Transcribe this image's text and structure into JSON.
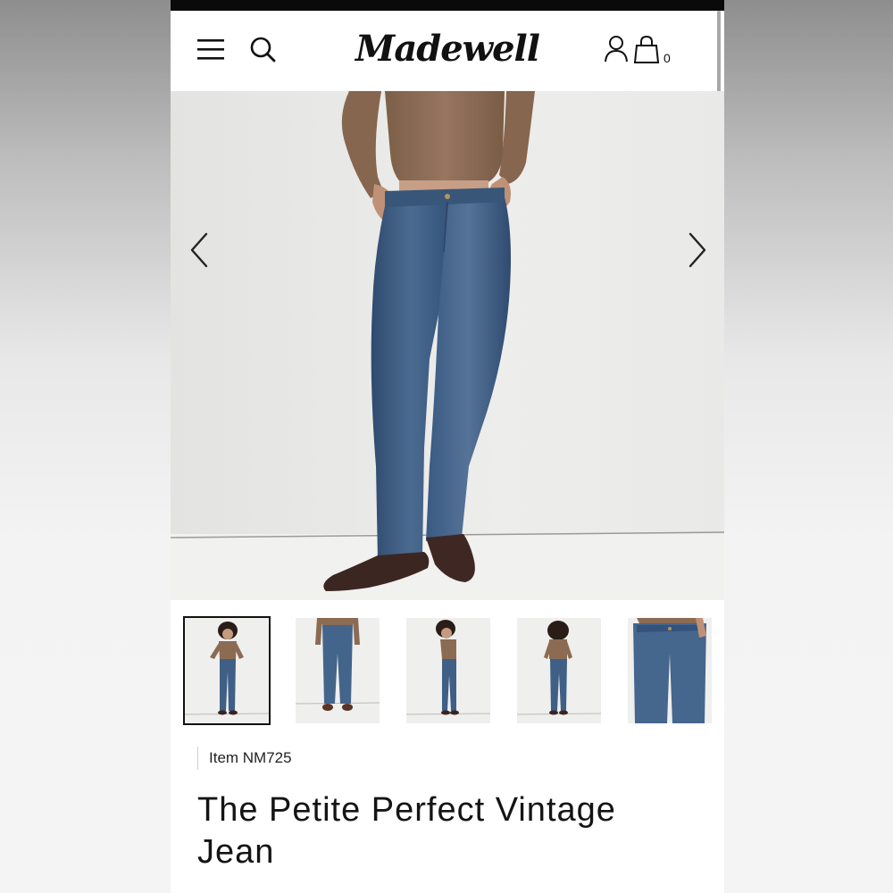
{
  "header": {
    "menu_icon": "hamburger-menu-icon",
    "search_icon": "search-icon",
    "logo_text": "Madewell",
    "account_icon": "user-account-icon",
    "bag_icon": "shopping-bag-icon",
    "bag_count": "0"
  },
  "gallery": {
    "prev_icon": "chevron-left-icon",
    "next_icon": "chevron-right-icon",
    "thumbnail_count": 5,
    "active_thumbnail": 1
  },
  "product": {
    "item_number": "Item NM725",
    "title": "The Petite Perfect Vintage Jean"
  },
  "colors": {
    "denim": "#3f5f86",
    "sweater": "#8a6a52",
    "shoe": "#3a2420",
    "background": "#eeeeec"
  }
}
